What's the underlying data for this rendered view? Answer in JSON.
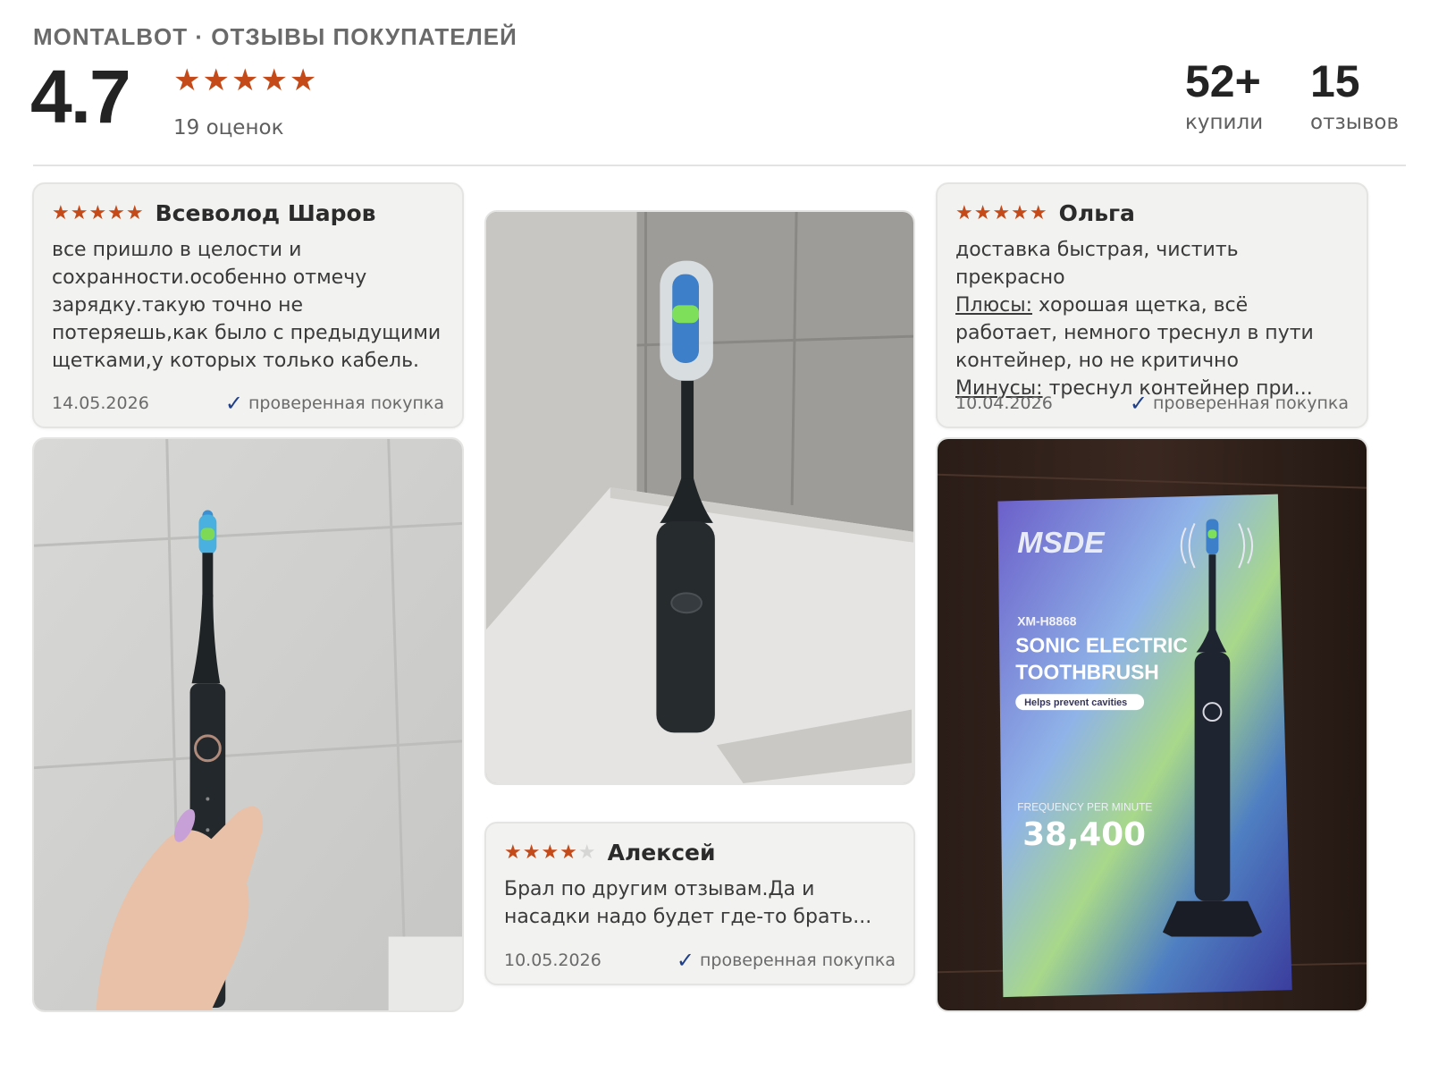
{
  "header": {
    "brand": "MONTALBOT · ОТЗЫВЫ ПОКУПАТЕЛЕЙ",
    "rating": "4.7",
    "stars": "★★★★★",
    "rating_count": "19 оценок",
    "stats": [
      {
        "value": "52+",
        "label": "купили"
      },
      {
        "value": "15",
        "label": "отзывов"
      }
    ]
  },
  "reviews": [
    {
      "stars": "★★★★★",
      "rating": 5,
      "author": "Всеволод Шаров",
      "text": "все пришло в целости и сохранности.особенно отмечу зарядку.такую точно не потеряешь,как было с предыдущими щетками,у которых только кабель.",
      "date": "14.05.2026",
      "verified": "проверенная покупка"
    },
    {
      "stars": "★★★★★",
      "rating": 5,
      "author": "Ольга",
      "text": "доставка быстрая, чистить прекрасно",
      "pros_label": "Плюсы:",
      "pros": "хорошая щетка, всё работает, немного треснул в пути контейнер, но не критично",
      "cons_label": "Минусы:",
      "cons": "треснул контейнер при...",
      "date": "10.04.2026",
      "verified": "проверенная покупка"
    },
    {
      "stars_filled": "★★★★",
      "stars_empty": "★",
      "rating": 4,
      "author": "Алексей",
      "text": "Брал по другим отзывам.Да и насадки надо будет где-то брать...",
      "date": "10.05.2026",
      "verified": "проверенная покупка"
    }
  ],
  "photos": {
    "box": {
      "brand": "MSDE",
      "model": "XM-H8868",
      "title_line1": "SONIC ELECTRIC",
      "title_line2": "TOOTHBRUSH",
      "badge": "Helps prevent cavities",
      "freq_label": "FREQUENCY PER MINUTE",
      "freq_value": "38,400"
    }
  },
  "icons": {
    "star": "star-icon",
    "check": "checkmark-icon"
  },
  "colors": {
    "star": "#c44a1a",
    "check": "#1f3f8a",
    "card_bg": "#f2f2f0"
  }
}
